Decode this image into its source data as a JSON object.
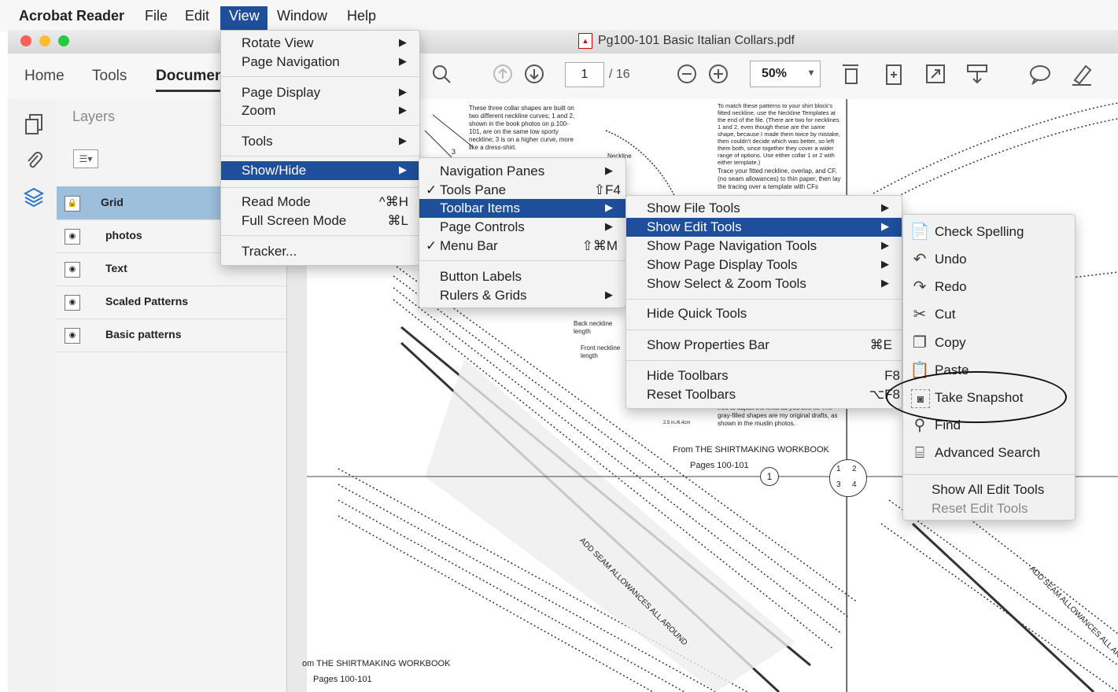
{
  "menubar": {
    "app": "Acrobat Reader",
    "items": [
      "File",
      "Edit",
      "View",
      "Window",
      "Help"
    ]
  },
  "window": {
    "title": "Pg100-101 Basic Italian Collars.pdf"
  },
  "tabs": [
    "Home",
    "Tools",
    "Documen"
  ],
  "toolbar": {
    "page_current": "1",
    "page_total": "/ 16",
    "zoom": "50%",
    "icons": [
      "search-icon",
      "page-up-icon",
      "page-down-icon",
      "zoom-out-icon",
      "zoom-in-icon",
      "fit-page-icon",
      "rotate-icon",
      "full-screen-icon",
      "scroll-mode-icon",
      "comment-icon",
      "highlight-icon"
    ]
  },
  "layers_panel": {
    "title": "Layers",
    "rows": [
      {
        "name": "Grid",
        "selected": true
      },
      {
        "name": "photos",
        "selected": false
      },
      {
        "name": "Text",
        "selected": false
      },
      {
        "name": "Scaled Patterns",
        "selected": false
      },
      {
        "name": "Basic patterns",
        "selected": false
      }
    ]
  },
  "view_menu": {
    "items": [
      {
        "label": "Rotate View",
        "submenu": true
      },
      {
        "label": "Page Navigation",
        "submenu": true
      },
      {
        "label": "Page Display",
        "submenu": true
      },
      {
        "label": "Zoom",
        "submenu": true
      },
      {
        "label": "Tools",
        "submenu": true
      },
      {
        "label": "Show/Hide",
        "submenu": true,
        "highlighted": true
      },
      {
        "label": "Read Mode",
        "shortcut": "^⌘H"
      },
      {
        "label": "Full Screen Mode",
        "shortcut": "⌘L"
      },
      {
        "label": "Tracker..."
      }
    ]
  },
  "showhide_menu": {
    "items": [
      {
        "label": "Navigation Panes",
        "submenu": true
      },
      {
        "label": "Tools Pane",
        "checked": true,
        "shortcut": "⇧F4"
      },
      {
        "label": "Toolbar Items",
        "submenu": true,
        "highlighted": true
      },
      {
        "label": "Page Controls",
        "submenu": true
      },
      {
        "label": "Menu Bar",
        "checked": true,
        "shortcut": "⇧⌘M"
      },
      {
        "label": "Button Labels"
      },
      {
        "label": "Rulers & Grids",
        "submenu": true
      }
    ]
  },
  "toolbar_items_menu": {
    "items": [
      {
        "label": "Show File Tools",
        "submenu": true
      },
      {
        "label": "Show Edit Tools",
        "submenu": true,
        "highlighted": true
      },
      {
        "label": "Show Page Navigation Tools",
        "submenu": true
      },
      {
        "label": "Show Page Display Tools",
        "submenu": true
      },
      {
        "label": "Show Select & Zoom Tools",
        "submenu": true
      },
      {
        "label": "Hide Quick Tools"
      },
      {
        "label": "Show Properties Bar",
        "shortcut": "⌘E"
      },
      {
        "label": "Hide Toolbars",
        "shortcut": "F8"
      },
      {
        "label": "Reset Toolbars",
        "shortcut": "⌥F8"
      }
    ]
  },
  "edit_tools_menu": {
    "items": [
      {
        "label": "Check Spelling",
        "icon": "check-spelling-icon"
      },
      {
        "label": "Undo",
        "icon": "undo-icon"
      },
      {
        "label": "Redo",
        "icon": "redo-icon"
      },
      {
        "label": "Cut",
        "icon": "scissors-icon"
      },
      {
        "label": "Copy",
        "icon": "copy-icon"
      },
      {
        "label": "Paste",
        "icon": "clipboard-icon"
      },
      {
        "label": "Take Snapshot",
        "icon": "camera-icon"
      },
      {
        "label": "Find",
        "icon": "magnifier-icon"
      },
      {
        "label": "Advanced Search",
        "icon": "binoculars-icon"
      }
    ],
    "footer": [
      "Show All Edit Tools",
      "Reset Edit Tools"
    ]
  },
  "document": {
    "text_block_1": "These three collar shapes are built on two different neckline curves; 1 and 2, shown in the book photos on p.100-101, are on the same low sporty neckline; 3 is on a higher curve, more like a dress-shirt.",
    "text_block_2": "To match these patterns to your shirt block's fitted neckline, use the Neckline Templates at the end of the file. (There are two for necklines 1 and 2, even though these are the same shape, because I made them twice by mistake, then couldn't decide which was better, so left them both, since together they cover a wider range of options. Use either collar 1 or 2 with either template.)",
    "text_block_3": "Trace your fitted neckline, overlap, and CF, (no seam allowances) to thin paper, then lay the tracing over a template with CFs",
    "neckline_label": "Neckline",
    "back_neckline": "Back neckline length",
    "front_neckline": "Front neckline length",
    "gray_note": "free to adjust the lines as you see fit. The gray-filled shapes are my original drafts, as shown in the muslin photos.",
    "footer_credit": "From THE SHIRTMAKING WORKBOOK",
    "footer_pages": "Pages 100-101",
    "footer_credit_2": "om THE SHIRTMAKING WORKBOOK",
    "footer_pages_2": "Pages 100-101",
    "seam_label": "ADD SEAM ALLOWANCES ALL AROUND",
    "circle_big": "1",
    "grid_cells": [
      "1",
      "2",
      "3",
      "4"
    ],
    "small_num": "3",
    "scale_note": "2.5 in./6.4cm"
  }
}
